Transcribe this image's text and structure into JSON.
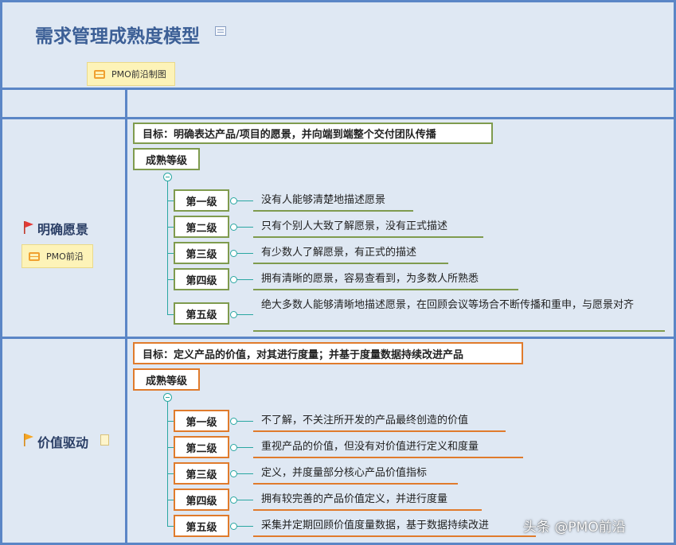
{
  "title": "需求管理成熟度模型",
  "source_tag": "PMO前沿制图",
  "sections": [
    {
      "name": "明确愿景",
      "tag": "PMO前沿",
      "goal": "目标：明确表达产品/项目的愿景，并向端到端整个交付团队传播",
      "maturity_label": "成熟等级",
      "levels": [
        {
          "level": "第一级",
          "desc": "没有人能够清楚地描述愿景"
        },
        {
          "level": "第二级",
          "desc": "只有个别人大致了解愿景，没有正式描述"
        },
        {
          "level": "第三级",
          "desc": "有少数人了解愿景，有正式的描述"
        },
        {
          "level": "第四级",
          "desc": "拥有清晰的愿景，容易查看到，为多数人所熟悉"
        },
        {
          "level": "第五级",
          "desc": "绝大多数人能够清晰地描述愿景，在回顾会议等场合不断传播和重申，与愿景对齐"
        }
      ]
    },
    {
      "name": "价值驱动",
      "goal": "目标：定义产品的价值，对其进行度量；并基于度量数据持续改进产品",
      "maturity_label": "成熟等级",
      "levels": [
        {
          "level": "第一级",
          "desc": "不了解，不关注所开发的产品最终创造的价值"
        },
        {
          "level": "第二级",
          "desc": "重视产品的价值，但没有对价值进行定义和度量"
        },
        {
          "level": "第三级",
          "desc": "定义，并度量部分核心产品价值指标"
        },
        {
          "level": "第四级",
          "desc": "拥有较完善的产品价值定义，并进行度量"
        },
        {
          "level": "第五级",
          "desc": "采集并定期回顾价值度量数据，基于数据持续改进"
        }
      ]
    }
  ],
  "watermark": "头条 @PMO前沿",
  "colors": {
    "accent_green": "#7f9b4e",
    "accent_orange": "#e07b2c",
    "connector": "#2aa7a2",
    "cell_bg": "#dfe8f3",
    "grid_line": "#5b86c6"
  }
}
